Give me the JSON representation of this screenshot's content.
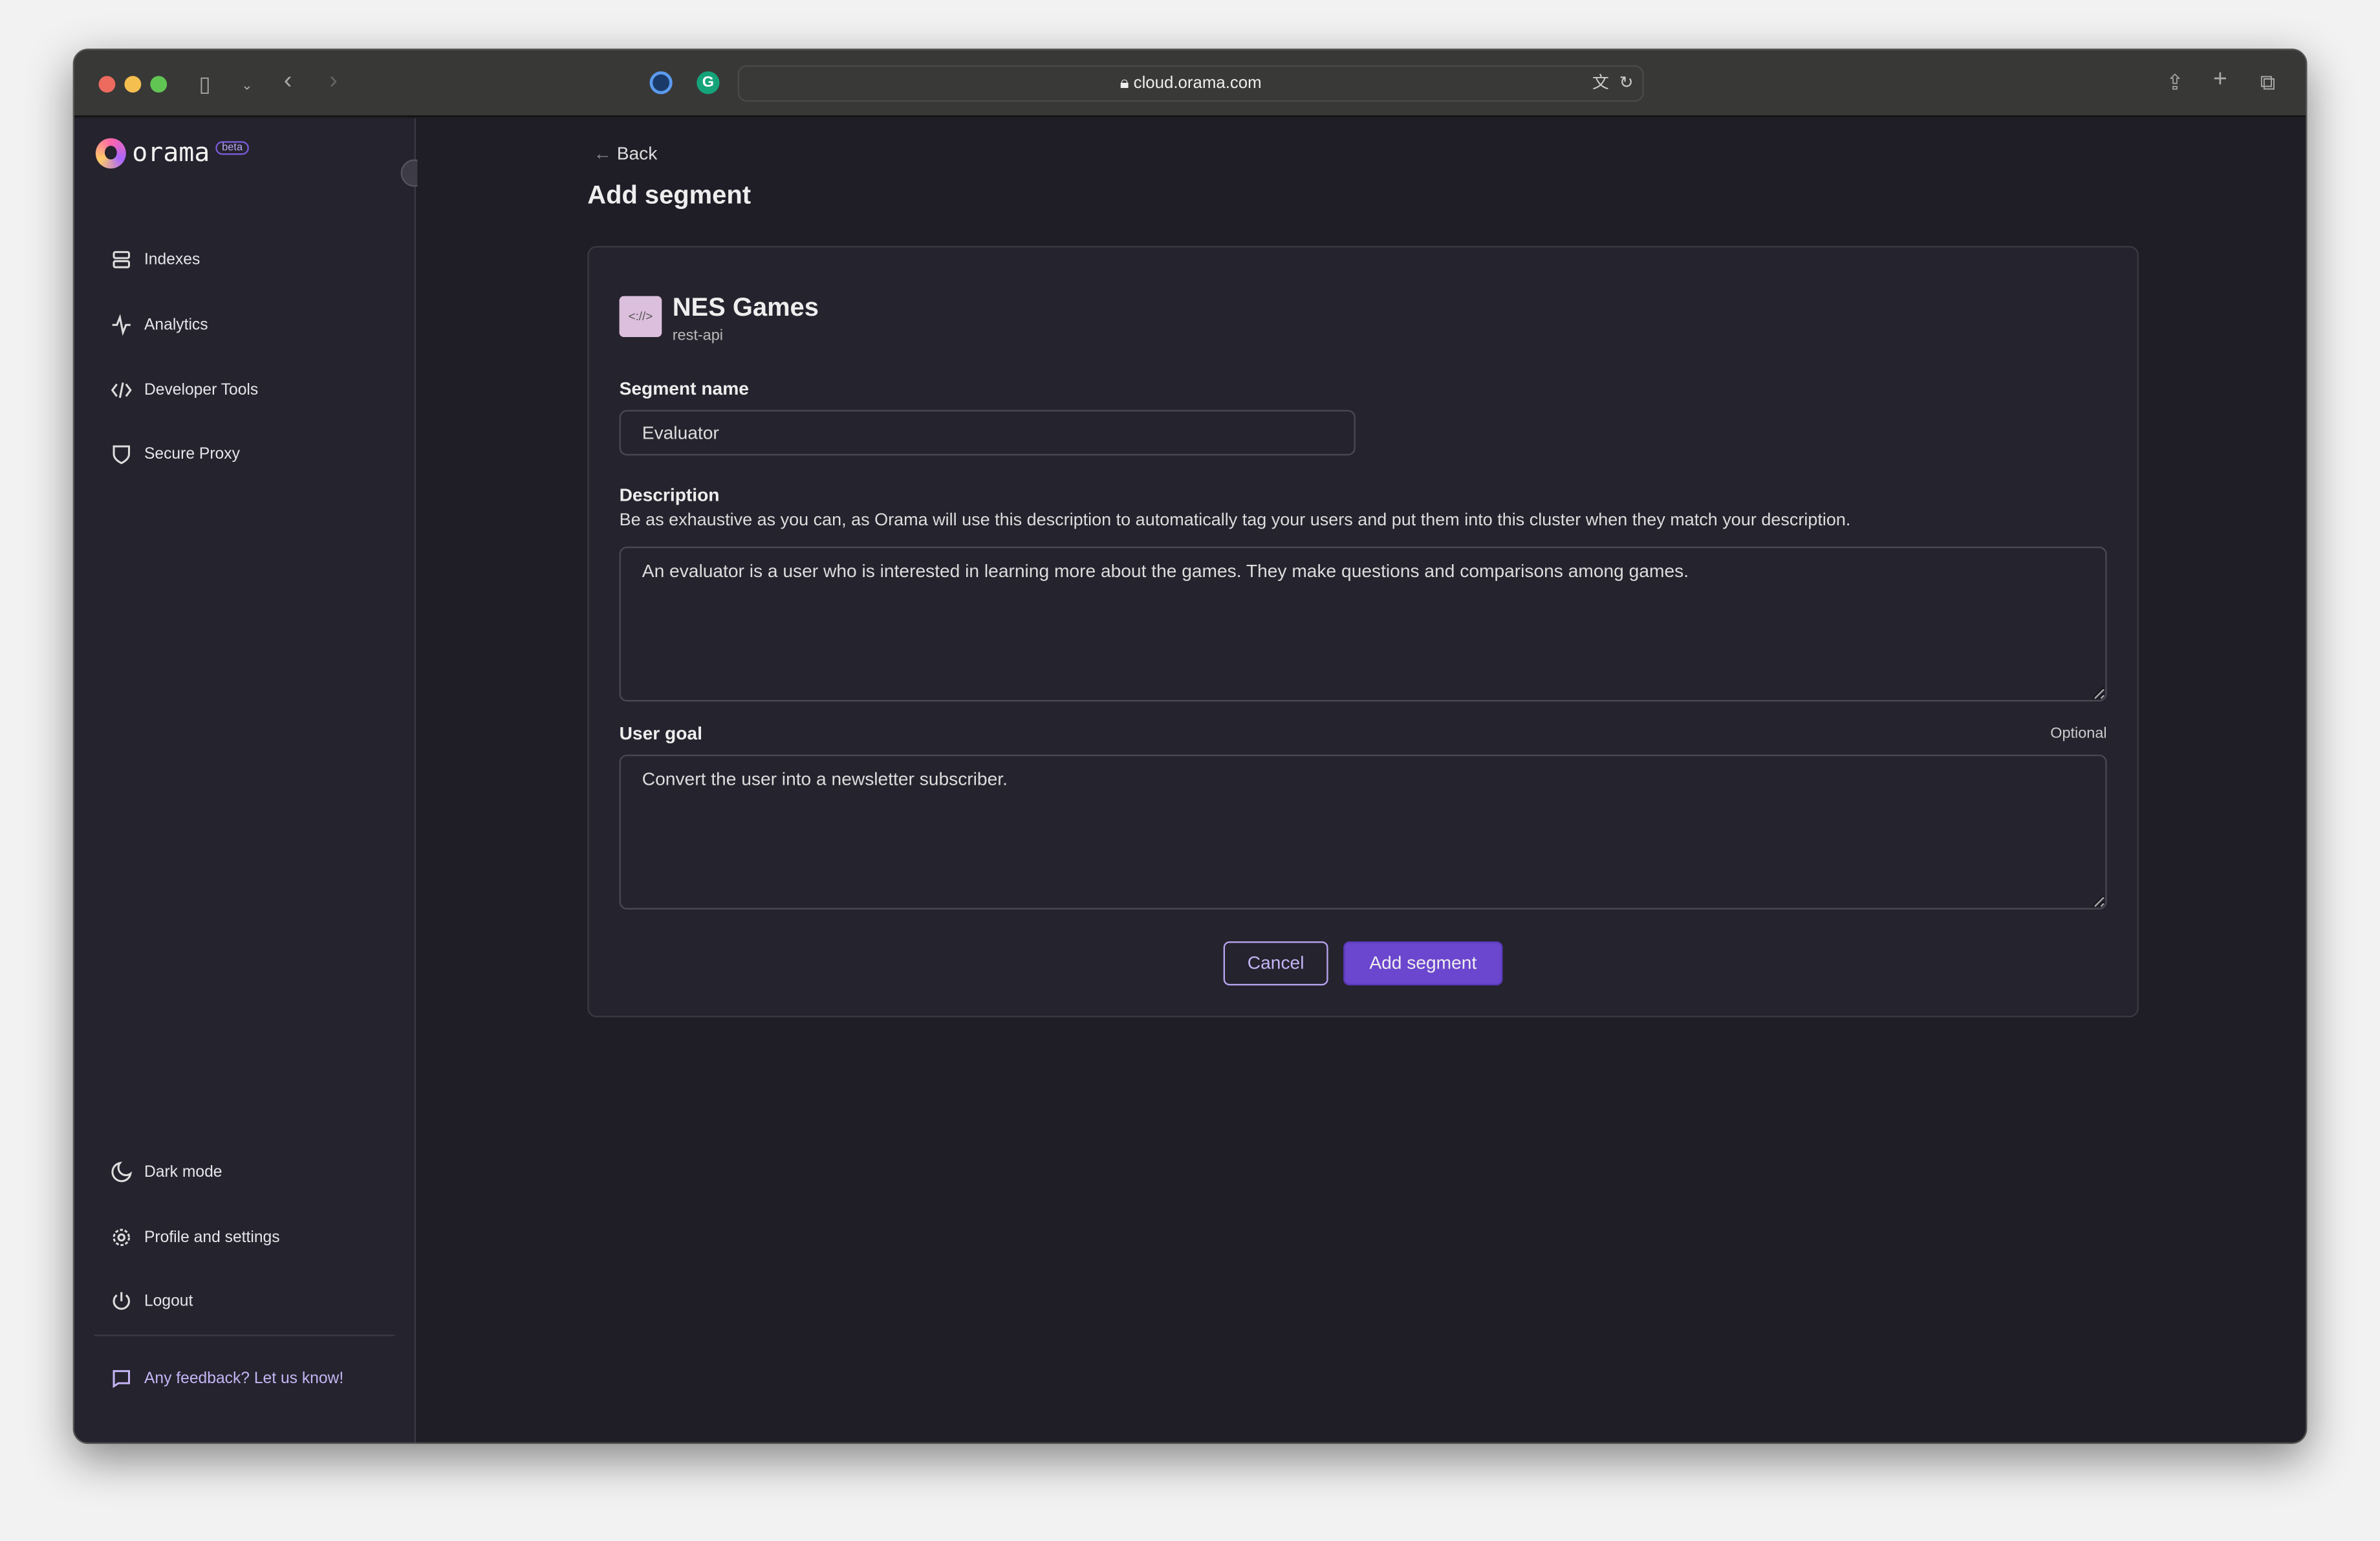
{
  "browser": {
    "url": "cloud.orama.com"
  },
  "brand": {
    "name": "orama",
    "badge": "beta"
  },
  "sidebar": {
    "items": [
      {
        "label": "Indexes",
        "icon": "database-icon"
      },
      {
        "label": "Analytics",
        "icon": "activity-icon"
      },
      {
        "label": "Developer Tools",
        "icon": "code-icon"
      },
      {
        "label": "Secure Proxy",
        "icon": "shield-icon"
      }
    ],
    "bottom": [
      {
        "label": "Dark mode",
        "icon": "moon-icon"
      },
      {
        "label": "Profile and settings",
        "icon": "gear-icon"
      },
      {
        "label": "Logout",
        "icon": "power-icon"
      }
    ],
    "feedback": "Any feedback? Let us know!"
  },
  "page": {
    "back": "Back",
    "title": "Add segment"
  },
  "index": {
    "name": "NES Games",
    "type": "rest-api",
    "icon_text": "<://>"
  },
  "form": {
    "segment_name_label": "Segment name",
    "segment_name_value": "Evaluator",
    "description_label": "Description",
    "description_help": "Be as exhaustive as you can, as Orama will use this description to automatically tag your users and put them into this cluster when they match your description.",
    "description_value": "An evaluator is a user who is interested in learning more about the games. They make questions and comparisons among games.",
    "goal_label": "User goal",
    "goal_optional": "Optional",
    "goal_value": "Convert the user into a newsletter subscriber.",
    "cancel": "Cancel",
    "submit": "Add segment"
  },
  "colors": {
    "accent": "#6b46ce",
    "accent_light": "#c4b5f5",
    "bg": "#1f1d26",
    "panel": "#25232d"
  }
}
